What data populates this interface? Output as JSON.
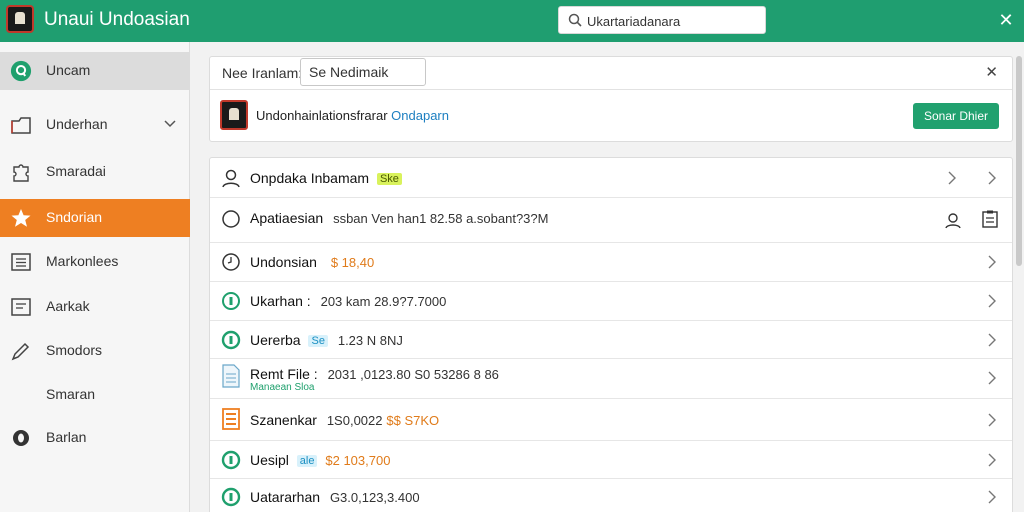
{
  "app": {
    "title": "Unaui Undoasian"
  },
  "search": {
    "value": "Ukartariadanara"
  },
  "sidebar": {
    "items": [
      {
        "label": "Uncam",
        "icon": "app-badge-icon"
      },
      {
        "label": "Underhan",
        "icon": "folder-icon"
      },
      {
        "label": "Smaradai",
        "icon": "puzzle-icon"
      },
      {
        "label": "Sndorian",
        "icon": "star-icon"
      },
      {
        "label": "Markonlees",
        "icon": "list-icon"
      },
      {
        "label": "Aarkak",
        "icon": "document-icon"
      },
      {
        "label": "Smodors",
        "icon": "pen-icon"
      },
      {
        "label": "Smaran",
        "icon": ""
      },
      {
        "label": "Barlan",
        "icon": "record-icon"
      }
    ]
  },
  "filter": {
    "label": "Nee Iranlam:",
    "input_value": "Se Nedimaik",
    "org_name_main": "Undonhainlationsfrarar",
    "org_name_highlight": "Ondaparn",
    "button_label": "Sonar Dhier"
  },
  "rows": [
    {
      "title": "Onpdaka Inbamam",
      "tag": "Ske",
      "icon": "user-icon"
    },
    {
      "title": "Apatiaesian",
      "meta": "ssban Ven han1 82.58 a.sobant?3?M",
      "icon": "circle-icon"
    },
    {
      "title": "Undonsian",
      "amount": "$ 18,40",
      "icon": "clock-icon"
    },
    {
      "title": "Ukarhan :",
      "meta": "203 kam 28.9?7.7000",
      "icon": "green-coin-icon"
    },
    {
      "title": "Uererba",
      "tag": "Se",
      "meta": "1.23 N 8NJ",
      "icon": "green-coin-icon"
    },
    {
      "title": "Remt File :",
      "meta": "2031 ,0123.80 S0 53286 8 86",
      "sub": "Manaean Sloa",
      "icon": "file-icon"
    },
    {
      "title": "Szanenkar",
      "meta": "1S0,0022",
      "amount": "$$ S7KO",
      "icon": "orange-doc-icon"
    },
    {
      "title": "Uesipl",
      "tag": "ale",
      "amount": "$2 103,700",
      "icon": "green-coin-icon"
    },
    {
      "title": "Uatararhan",
      "meta": "G3.0,123,3.400",
      "icon": "green-coin-icon"
    }
  ],
  "colors": {
    "brand": "#1f9e70",
    "accent": "#ee7f22",
    "primary_button": "#21a16f"
  }
}
